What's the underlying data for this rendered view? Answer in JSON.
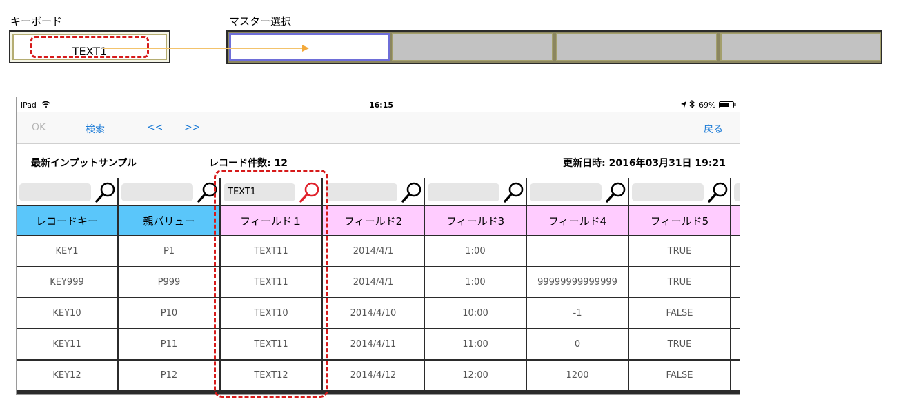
{
  "diagram": {
    "keyboard_label": "キーボード",
    "keyboard_value": "TEXT1",
    "master_label": "マスター選択"
  },
  "status_bar": {
    "device": "iPad",
    "time": "16:15",
    "battery": "69%"
  },
  "nav": {
    "ok": "OK",
    "search": "検索",
    "prev": "<<",
    "next": ">>",
    "back": "戻る"
  },
  "info": {
    "title": "最新インプットサンプル",
    "record_count": "レコード件数: 12",
    "updated": "更新日時: 2016年03月31日 19:21"
  },
  "columns": [
    {
      "header": "レコードキー",
      "color": "blue",
      "search": "",
      "cells": [
        "KEY1",
        "KEY999",
        "KEY10",
        "KEY11",
        "KEY12"
      ]
    },
    {
      "header": "親バリュー",
      "color": "blue",
      "search": "",
      "cells": [
        "P1",
        "P999",
        "P10",
        "P11",
        "P12"
      ]
    },
    {
      "header": "フィールド１",
      "color": "pink",
      "search": "TEXT1",
      "search_active": true,
      "cells": [
        "TEXT11",
        "TEXT11",
        "TEXT10",
        "TEXT11",
        "TEXT12"
      ]
    },
    {
      "header": "フィールド2",
      "color": "pink",
      "search": "",
      "cells": [
        "2014/4/1",
        "2014/4/1",
        "2014/4/10",
        "2014/4/11",
        "2014/4/12"
      ]
    },
    {
      "header": "フィールド3",
      "color": "pink",
      "search": "",
      "cells": [
        "1:00",
        "1:00",
        "10:00",
        "11:00",
        "12:00"
      ]
    },
    {
      "header": "フィールド4",
      "color": "pink",
      "search": "",
      "cells": [
        "",
        "99999999999999",
        "-1",
        "0",
        "1200"
      ]
    },
    {
      "header": "フィールド5",
      "color": "pink",
      "search": "",
      "cells": [
        "TRUE",
        "TRUE",
        "FALSE",
        "TRUE",
        "FALSE"
      ]
    }
  ],
  "colors": {
    "key_header": "#5ac6fa",
    "field_header": "#ffccff",
    "nav_link": "#1a7ad6",
    "highlight": "#d61a1a"
  }
}
